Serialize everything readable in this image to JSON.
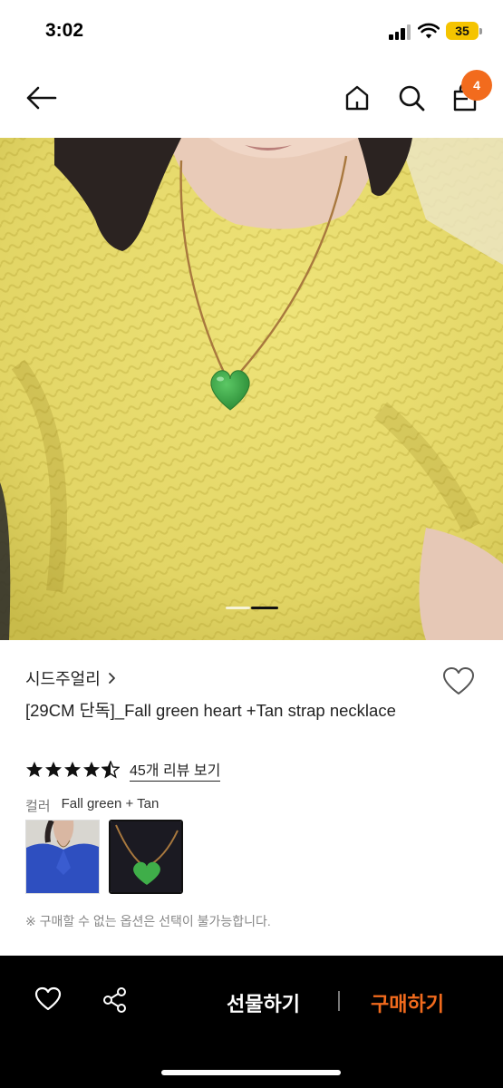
{
  "status": {
    "time": "3:02",
    "battery": "35"
  },
  "nav": {
    "cart_count": "4"
  },
  "product": {
    "brand": "시드주얼리",
    "title": "[29CM 단독]_Fall green heart +Tan strap necklace",
    "rating": 4.5,
    "review_link": "45개 리뷰 보기",
    "option_label": "컬러",
    "option_value": "Fall green + Tan",
    "notice": "※ 구매할 수 없는 옵션은 선택이 불가능합니다."
  },
  "gallery": {
    "current_page": 2,
    "page_count": 2
  },
  "bottom_bar": {
    "gift_label": "선물하기",
    "buy_label": "구매하기"
  },
  "colors": {
    "accent": "#f26b1d",
    "sweater": "#e6dc6e",
    "pendant": "#3aa845"
  },
  "icons": [
    "back-arrow-icon",
    "home-icon",
    "search-icon",
    "shopping-bag-icon",
    "heart-icon",
    "share-icon",
    "star-icon",
    "chevron-right-icon"
  ]
}
